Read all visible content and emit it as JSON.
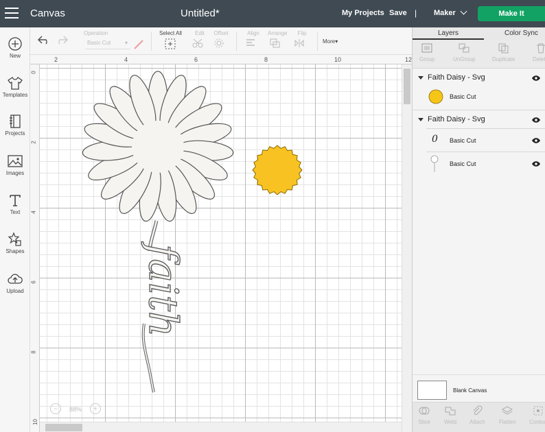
{
  "header": {
    "app_name": "Canvas",
    "doc_title": "Untitled*",
    "my_projects": "My Projects",
    "save": "Save",
    "separator": "|",
    "machine": "Maker",
    "make_it": "Make It"
  },
  "sidebar": {
    "items": [
      {
        "label": "New",
        "icon": "plus-circle-icon"
      },
      {
        "label": "Templates",
        "icon": "tshirt-icon"
      },
      {
        "label": "Projects",
        "icon": "book-icon"
      },
      {
        "label": "Images",
        "icon": "image-icon"
      },
      {
        "label": "Text",
        "icon": "text-icon"
      },
      {
        "label": "Shapes",
        "icon": "shapes-icon"
      },
      {
        "label": "Upload",
        "icon": "cloud-upload-icon"
      }
    ]
  },
  "toolbar": {
    "operation_label": "Operation",
    "operation_value": "Basic Cut",
    "select_all": "Select All",
    "edit": "Edit",
    "offset": "Offset",
    "align": "Align",
    "arrange": "Arrange",
    "flip": "Flip",
    "more": "More"
  },
  "rulers": {
    "top": [
      "2",
      "4",
      "6",
      "8",
      "10",
      "12"
    ],
    "left": [
      "0",
      "2",
      "4",
      "6",
      "8",
      "10"
    ]
  },
  "zoom": {
    "minus": "−",
    "value": "88%",
    "plus": "+"
  },
  "panel": {
    "tabs": [
      "Layers",
      "Color Sync"
    ],
    "tools": [
      "Group",
      "UnGroup",
      "Duplicate",
      "Delete"
    ],
    "groups": [
      {
        "name": "Faith Daisy - Svg",
        "layers": [
          {
            "name": "Basic Cut",
            "color": "#f5c518"
          }
        ]
      },
      {
        "name": "Faith Daisy - Svg",
        "layers": [
          {
            "name": "Basic Cut",
            "thumb_text": "0"
          },
          {
            "name": "Basic Cut"
          }
        ]
      }
    ],
    "blank_canvas": "Blank Canvas",
    "bottom_tools": [
      "Slice",
      "Weld",
      "Attach",
      "Flatten",
      "Contour"
    ]
  },
  "canvas_objects": {
    "daisy_petal_color": "#f5f4f0",
    "daisy_center_color": "#f8c322",
    "word": "faith"
  }
}
